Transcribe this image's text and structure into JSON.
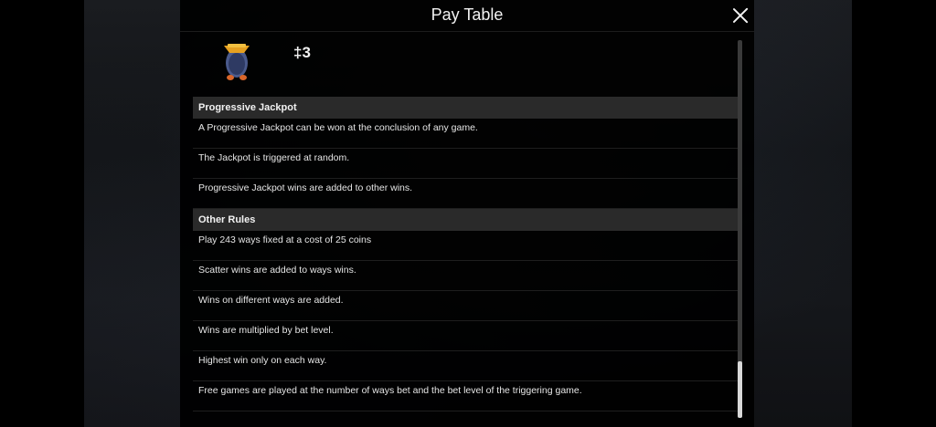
{
  "header": {
    "title": "Pay Table"
  },
  "symbol": {
    "icon": "bird-icon",
    "value": "‡3"
  },
  "sections": [
    {
      "title": "Progressive Jackpot",
      "rules": [
        "A Progressive Jackpot can be won at the conclusion of any game.",
        "The Jackpot is triggered at random.",
        "Progressive Jackpot wins are added to other wins."
      ]
    },
    {
      "title": "Other Rules",
      "rules": [
        "Play 243 ways fixed at a cost of 25 coins",
        "Scatter wins are added to ways wins.",
        "Wins on different ways are added.",
        "Wins are multiplied by bet level.",
        "Highest win only on each way.",
        "Free games are played at the number of ways bet and the bet level of the triggering game."
      ]
    }
  ],
  "scroll": {
    "position_fraction": 0.85
  }
}
